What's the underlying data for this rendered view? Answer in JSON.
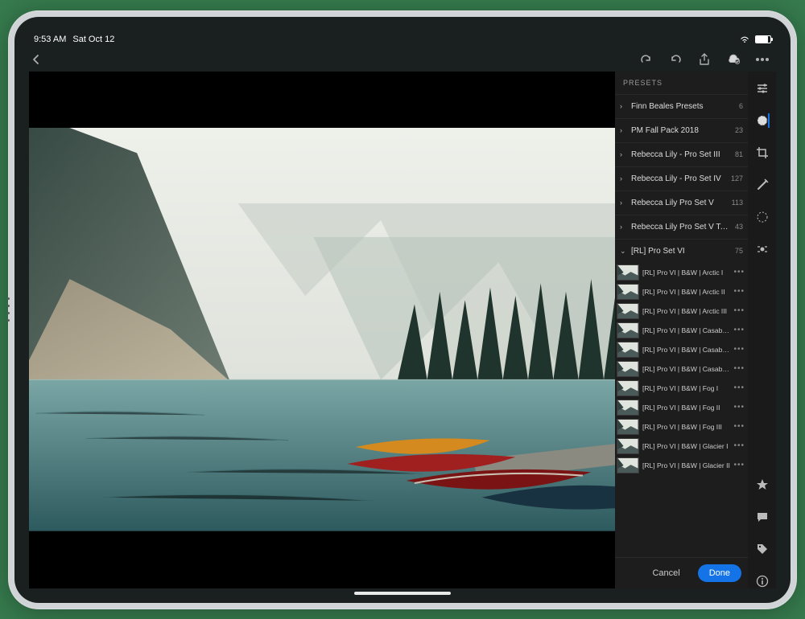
{
  "status": {
    "time": "9:53 AM",
    "date": "Sat Oct 12"
  },
  "panel": {
    "title": "PRESETS",
    "groups": [
      {
        "label": "Finn Beales Presets",
        "count": "6",
        "open": false
      },
      {
        "label": "PM Fall Pack 2018",
        "count": "23",
        "open": false
      },
      {
        "label": "Rebecca Lily - Pro Set III",
        "count": "81",
        "open": false
      },
      {
        "label": "Rebecca Lily - Pro Set IV",
        "count": "127",
        "open": false
      },
      {
        "label": "Rebecca Lily Pro Set V",
        "count": "113",
        "open": false
      },
      {
        "label": "Rebecca Lily Pro Set V Tools",
        "count": "43",
        "open": false
      },
      {
        "label": "[RL] Pro Set VI",
        "count": "75",
        "open": true
      }
    ],
    "presets": [
      {
        "name": "[RL] Pro VI | B&W | Arctic I"
      },
      {
        "name": "[RL] Pro VI | B&W | Arctic II"
      },
      {
        "name": "[RL] Pro VI | B&W | Arctic III"
      },
      {
        "name": "[RL] Pro VI | B&W | Casabl…"
      },
      {
        "name": "[RL] Pro VI | B&W | Casabl…"
      },
      {
        "name": "[RL] Pro VI | B&W | Casabl…"
      },
      {
        "name": "[RL] Pro VI | B&W | Fog I"
      },
      {
        "name": "[RL] Pro VI | B&W | Fog II"
      },
      {
        "name": "[RL] Pro VI | B&W | Fog III"
      },
      {
        "name": "[RL] Pro VI | B&W | Glacier I"
      },
      {
        "name": "[RL] Pro VI | B&W | Glacier II"
      }
    ],
    "cancel": "Cancel",
    "done": "Done"
  }
}
